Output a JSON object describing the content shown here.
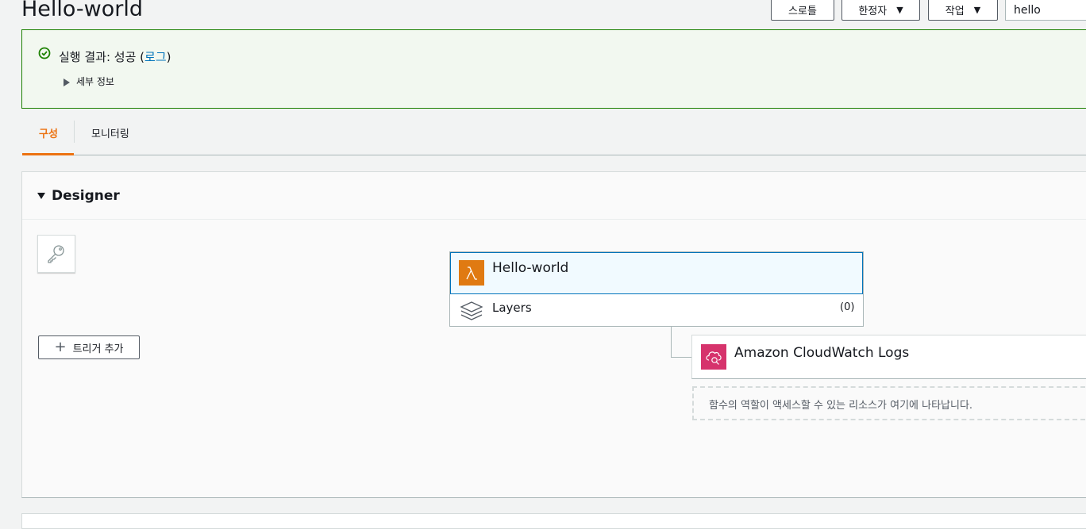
{
  "header": {
    "title": "Hello-world",
    "throttle_label": "스로틀",
    "qualifier_label": "한정자",
    "actions_label": "작업",
    "search_value": "hello"
  },
  "banner": {
    "result_prefix": "실행 결과: 성공 (",
    "log_link": "로그",
    "result_suffix": ")",
    "details_label": "세부 정보",
    "status_color": "#1d8102"
  },
  "tabs": [
    {
      "label": "구성",
      "active": true
    },
    {
      "label": "모니터링",
      "active": false
    }
  ],
  "designer": {
    "title": "Designer",
    "add_trigger_label": "트리거 추가",
    "function_name": "Hello-world",
    "layers_label": "Layers",
    "layers_count": "(0)",
    "destination_label": "Amazon CloudWatch Logs",
    "resources_hint": "함수의 역할이 액세스할 수 있는 리소스가 여기에 나타납니다."
  },
  "colors": {
    "accent": "#ec7211",
    "link": "#0073bb",
    "lambda": "#e07a12",
    "cloudwatch": "#d6336c"
  }
}
